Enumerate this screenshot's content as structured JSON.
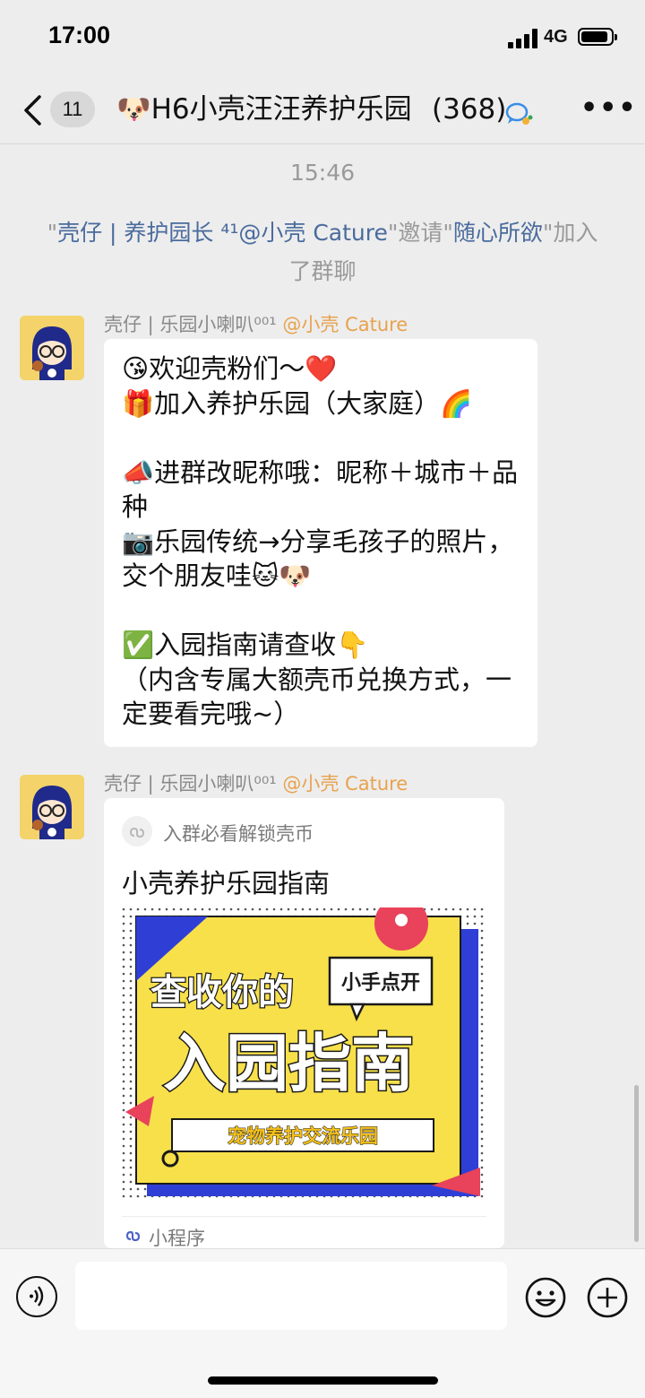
{
  "status_bar": {
    "time": "17:00",
    "network": "4G"
  },
  "nav": {
    "unread_count": "11",
    "title": "🐶H6小壳汪汪养护乐园",
    "member_count": "(368)"
  },
  "chat": {
    "timestamp": "15:46",
    "system_message": {
      "q1": "\"",
      "inviter": "壳仔 | 养护园长 ⁴¹@小壳 Cature",
      "q2": "\"",
      "invite_word": "邀请",
      "q3": "\"",
      "invitee": "随心所欲",
      "q4": "\"",
      "joined": "加入了群聊"
    },
    "messages": [
      {
        "sender_name": "壳仔 | 乐园小喇叭⁰⁰¹",
        "sender_at": "@小壳 Cature",
        "text": "😘欢迎壳粉们～❤️\n🎁加入养护乐园（大家庭）🌈\n\n📣进群改昵称哦：昵称＋城市＋品种\n📷乐园传统→分享毛孩子的照片，交个朋友哇🐱🐶\n\n✅入园指南请查收👇\n（内含专属大额壳币兑换方式，一定要看完哦~）"
      },
      {
        "sender_name": "壳仔 | 乐园小喇叭⁰⁰¹",
        "sender_at": "@小壳 Cature",
        "card": {
          "source": "入群必看解锁壳币",
          "title": "小壳养护乐园指南",
          "poster": {
            "line1": "查收你的",
            "tag": "小手点开",
            "line2": "入园指南",
            "banner": "宠物养护交流乐园"
          },
          "footer": "小程序"
        }
      }
    ]
  },
  "colors": {
    "link": "#4a6b9d",
    "at": "#e8a24e",
    "poster_yellow": "#f7e04a",
    "poster_blue": "#2f3fd6",
    "poster_red": "#e8435a"
  }
}
